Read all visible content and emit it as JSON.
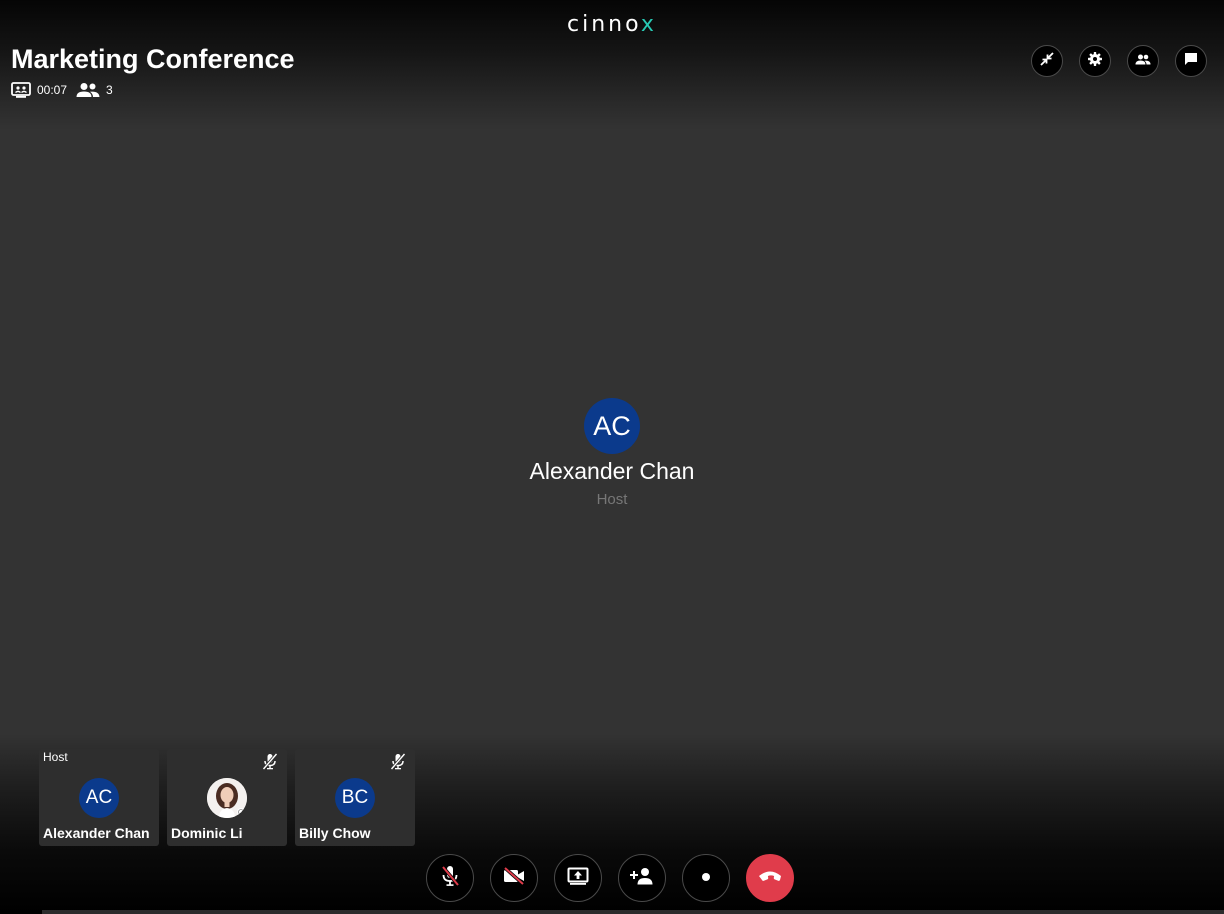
{
  "app": {
    "logo_main": "cinno",
    "logo_accent": "x"
  },
  "conference": {
    "title": "Marketing Conference",
    "duration": "00:07",
    "participant_count": "3"
  },
  "top_actions": [
    {
      "name": "minimize",
      "icon": "minimize-icon"
    },
    {
      "name": "settings",
      "icon": "gear-icon"
    },
    {
      "name": "participants",
      "icon": "people-icon"
    },
    {
      "name": "chat",
      "icon": "chat-icon"
    }
  ],
  "speaker": {
    "initials": "AC",
    "name": "Alexander Chan",
    "role": "Host",
    "avatar_color": "#0b3a8c"
  },
  "participants": [
    {
      "role": "Host",
      "initials": "AC",
      "name": "Alexander Chan",
      "muted": false,
      "has_photo": false
    },
    {
      "role": "",
      "initials": "",
      "name": "Dominic Li",
      "muted": true,
      "has_photo": true
    },
    {
      "role": "",
      "initials": "BC",
      "name": "Billy Chow",
      "muted": true,
      "has_photo": false
    }
  ],
  "controls": [
    {
      "name": "mute",
      "icon": "mic-off-icon"
    },
    {
      "name": "video",
      "icon": "video-off-icon"
    },
    {
      "name": "share-screen",
      "icon": "screen-share-icon"
    },
    {
      "name": "add-participant",
      "icon": "person-add-icon"
    },
    {
      "name": "record",
      "icon": "record-icon"
    },
    {
      "name": "end-call",
      "icon": "phone-hangup-icon"
    }
  ],
  "colors": {
    "background": "#333333",
    "avatar": "#0b3a8c",
    "end_call": "#e03c4b",
    "logo_accent": "#28c9b4"
  }
}
